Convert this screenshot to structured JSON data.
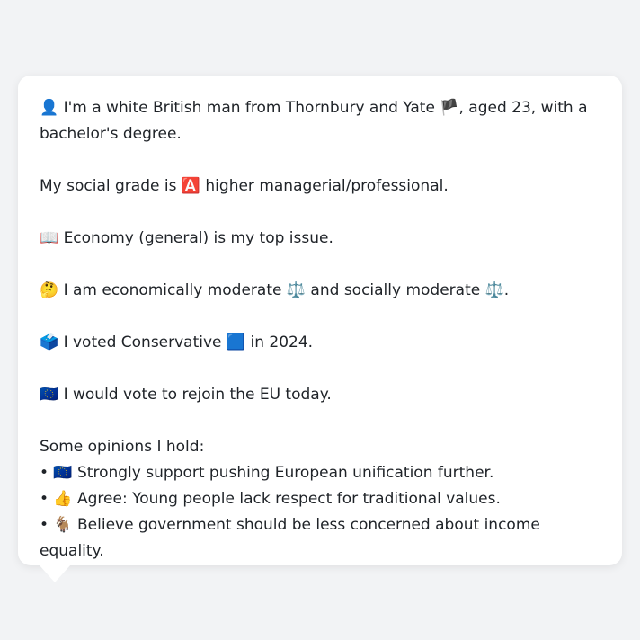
{
  "profile": {
    "intro_before": "👤 I'm a white British man from Thornbury and Yate ",
    "intro_flag": "🏴",
    "intro_after": ", aged 23, with a bachelor's degree.",
    "social_grade": "My social grade is 🅰️ higher managerial/professional.",
    "top_issue": "📖 Economy (general) is my top issue.",
    "ideology": "🤔 I am economically moderate ⚖️ and socially moderate ⚖️.",
    "vote_2024": "🗳️ I voted Conservative 🟦 in 2024.",
    "eu_vote": "🇪🇺 I would vote to rejoin the EU today.",
    "opinions_heading": "Some opinions I hold:",
    "opinions": [
      "• 🇪🇺 Strongly support pushing European unification further.",
      "• 👍 Agree: Young people lack respect for traditional values.",
      "• 🐐 Believe government should be less concerned about income equality."
    ]
  }
}
